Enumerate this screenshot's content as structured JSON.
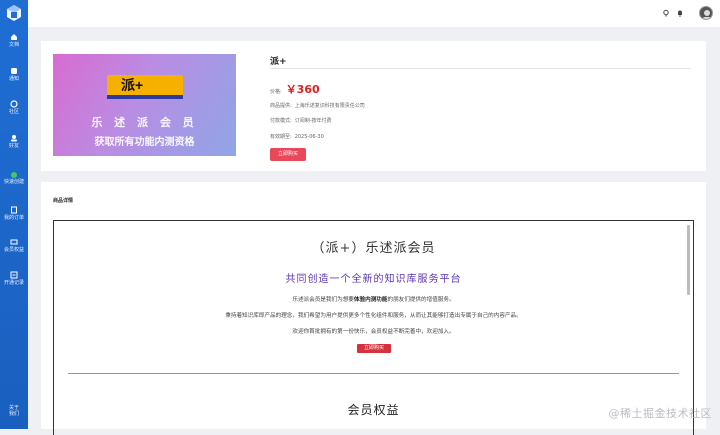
{
  "sidebar": {
    "items": [
      {
        "label": "文档",
        "icon": "home-icon"
      },
      {
        "label": "通知",
        "icon": "bell-icon"
      },
      {
        "label": "社区",
        "icon": "community-icon"
      },
      {
        "label": "好友",
        "icon": "friends-icon"
      },
      {
        "label": "快速创建",
        "icon": "plus-circle-icon"
      },
      {
        "label": "我的订单",
        "icon": "order-icon"
      },
      {
        "label": "会员权益",
        "icon": "vip-icon"
      },
      {
        "label": "开通记录",
        "icon": "record-icon"
      }
    ],
    "footer": [
      "关于",
      "我们"
    ]
  },
  "product": {
    "title": "派+",
    "banner_tag": "派+",
    "banner_line1": "乐 述 派 会 员",
    "banner_line2": "获取所有功能内测资格",
    "price_label": "价格:",
    "price": "￥360",
    "vendor_label": "商品提供:",
    "vendor": "上海乐述复识科技有限责任公司",
    "pay_label": "付款模式:",
    "pay": "订阅制-按年付费",
    "expire_label": "有效期至:",
    "expire": "2025-06-30",
    "buy_label": "立即购买"
  },
  "detail": {
    "section_title": "商品详情",
    "heading": "（派+）乐述派会员",
    "subheading": "共同创造一个全新的知识库服务平台",
    "p1_a": "乐述派会员是我们为想要",
    "p1_b": "体验内测功能",
    "p1_c": "的朋友们提供的增值服务。",
    "p2": "秉持着知识库即产品的理念，我们希望为用户提供更多个性化组件和服务，从而让其能够打造出专属于自己的内容产品。",
    "p3": "欢迎你首批拥有的第一份快乐，会员权益不断完善中，欢迎加入。",
    "mini_buy": "立即购买",
    "heading2": "会员权益"
  },
  "watermark": "@稀土掘金技术社区",
  "colors": {
    "sidebar": "#1f6ed4",
    "price": "#e02020",
    "accent": "#5b34b5",
    "buy": "#e8485a"
  }
}
